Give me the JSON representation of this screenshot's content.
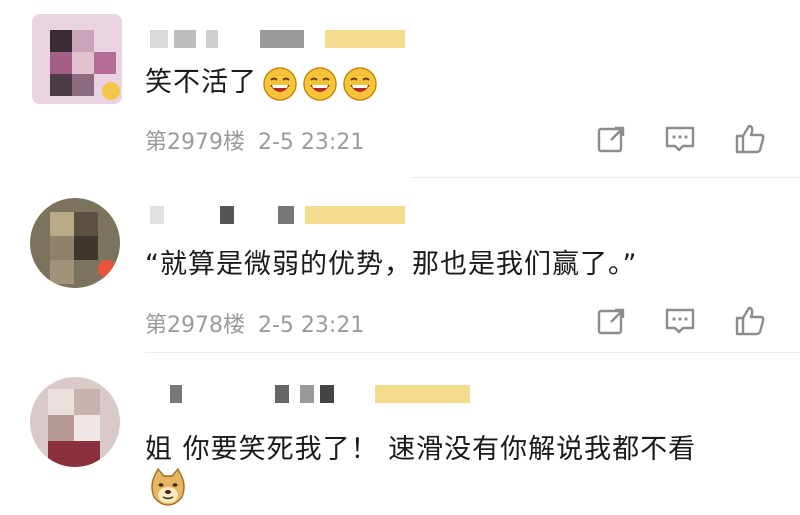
{
  "comments": [
    {
      "text": "笑不活了",
      "emoji": [
        "laughing-emoji",
        "laughing-emoji",
        "laughing-emoji"
      ],
      "floor": "第2979楼",
      "time": "2-5 23:21"
    },
    {
      "text": "“就算是微弱的优势，那也是我们赢了。”",
      "floor": "第2978楼",
      "time": "2-5 23:21"
    },
    {
      "text": "姐 你要笑死我了！ 速滑没有你解说我都不看",
      "emoji": [
        "doge-emoji"
      ]
    }
  ],
  "icons": {
    "share": "share-icon",
    "comment": "comment-icon",
    "like": "thumbs-up-icon"
  },
  "colors": {
    "text": "#1a1a1a",
    "meta": "#9a9a9a",
    "icon": "#8c8c8c",
    "badge": "#f5c54a"
  }
}
